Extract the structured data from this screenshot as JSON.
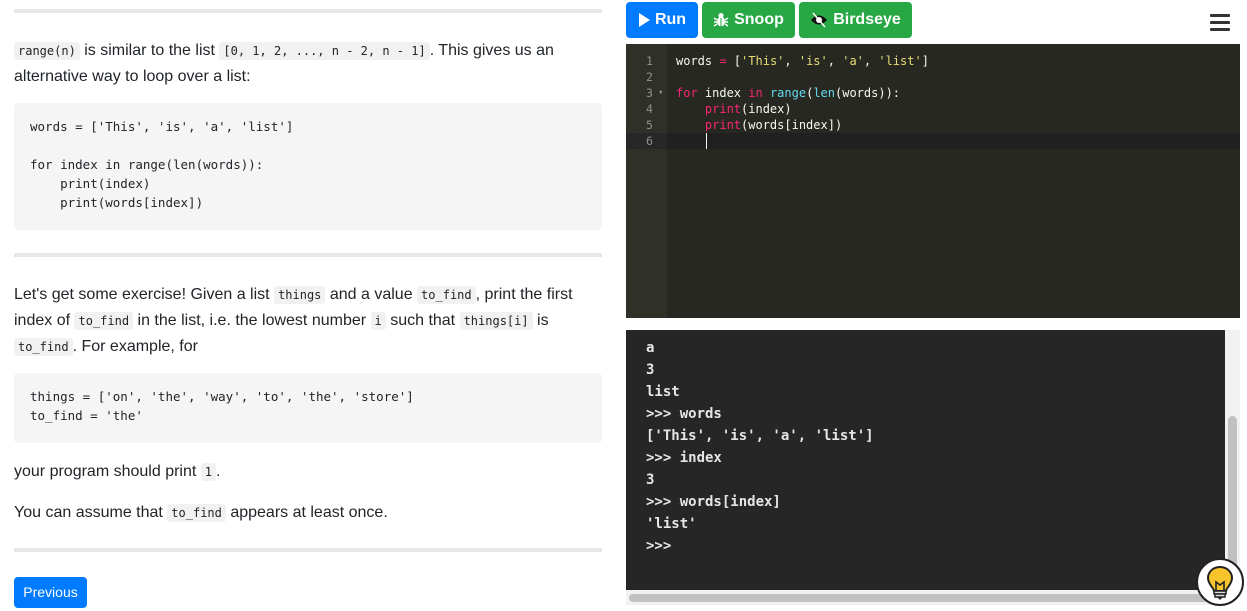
{
  "instructions": {
    "p1": {
      "code1": "range(n)",
      "t1": " is similar to the list ",
      "code2": "[0, 1, 2, ..., n - 2, n - 1]",
      "t2": ". This gives us an",
      "line2": "alternative way to loop over a list:"
    },
    "example1": [
      "words = ['This', 'is', 'a', 'list']",
      "",
      "for index in range(len(words)):",
      "    print(index)",
      "    print(words[index])"
    ],
    "p2": {
      "t1": "Let's get some exercise! Given a list ",
      "c1": "things",
      "t2": " and a value ",
      "c2": "to_find",
      "t3": ", print the first",
      "t4": "index of ",
      "c3": "to_find",
      "t5": " in the list, i.e. the lowest number ",
      "c4": "i",
      "t6": " such that ",
      "c5": "things[i]",
      "t7": " is",
      "c6": "to_find",
      "t8": ". For example, for"
    },
    "example2": [
      "things = ['on', 'the', 'way', 'to', 'the', 'store']",
      "to_find = 'the'"
    ],
    "p3": {
      "t1": "your program should print ",
      "c1": "1",
      "t2": "."
    },
    "p4": {
      "t1": "You can assume that ",
      "c1": "to_find",
      "t2": " appears at least once."
    },
    "previous_label": "Previous"
  },
  "toolbar": {
    "run_label": "Run",
    "snoop_label": "Snoop",
    "birdseye_label": "Birdseye"
  },
  "editor": {
    "line_numbers": [
      "1",
      "2",
      "3",
      "4",
      "5",
      "6"
    ],
    "fold_marker": "▾",
    "line1": {
      "a": "words ",
      "b": "=",
      "c": " [",
      "d": "'This'",
      "e": ", ",
      "f": "'is'",
      "g": ", ",
      "h": "'a'",
      "i": ", ",
      "j": "'list'",
      "k": "]"
    },
    "line3": {
      "a": "for",
      "b": " index ",
      "c": "in",
      "d": " ",
      "e": "range",
      "f": "(",
      "g": "len",
      "h": "(words)):"
    },
    "line4": {
      "a": "    ",
      "b": "print",
      "c": "(index)"
    },
    "line5": {
      "a": "    ",
      "b": "print",
      "c": "(words[index])"
    }
  },
  "console": {
    "lines": [
      "a",
      "3",
      "list",
      ">>> words",
      "['This', 'is', 'a', 'list']",
      ">>> index",
      "3",
      ">>> words[index]",
      "'list'",
      ">>>"
    ]
  },
  "colors": {
    "run": "#007bff",
    "snoop": "#28a745",
    "birdseye": "#28a745",
    "editor_bg": "#272822",
    "console_bg": "#262626"
  },
  "icons": {
    "run": "play-icon",
    "snoop": "bug-icon",
    "birdseye": "eye-icon",
    "menu": "hamburger-icon",
    "hint": "lightbulb-icon"
  }
}
